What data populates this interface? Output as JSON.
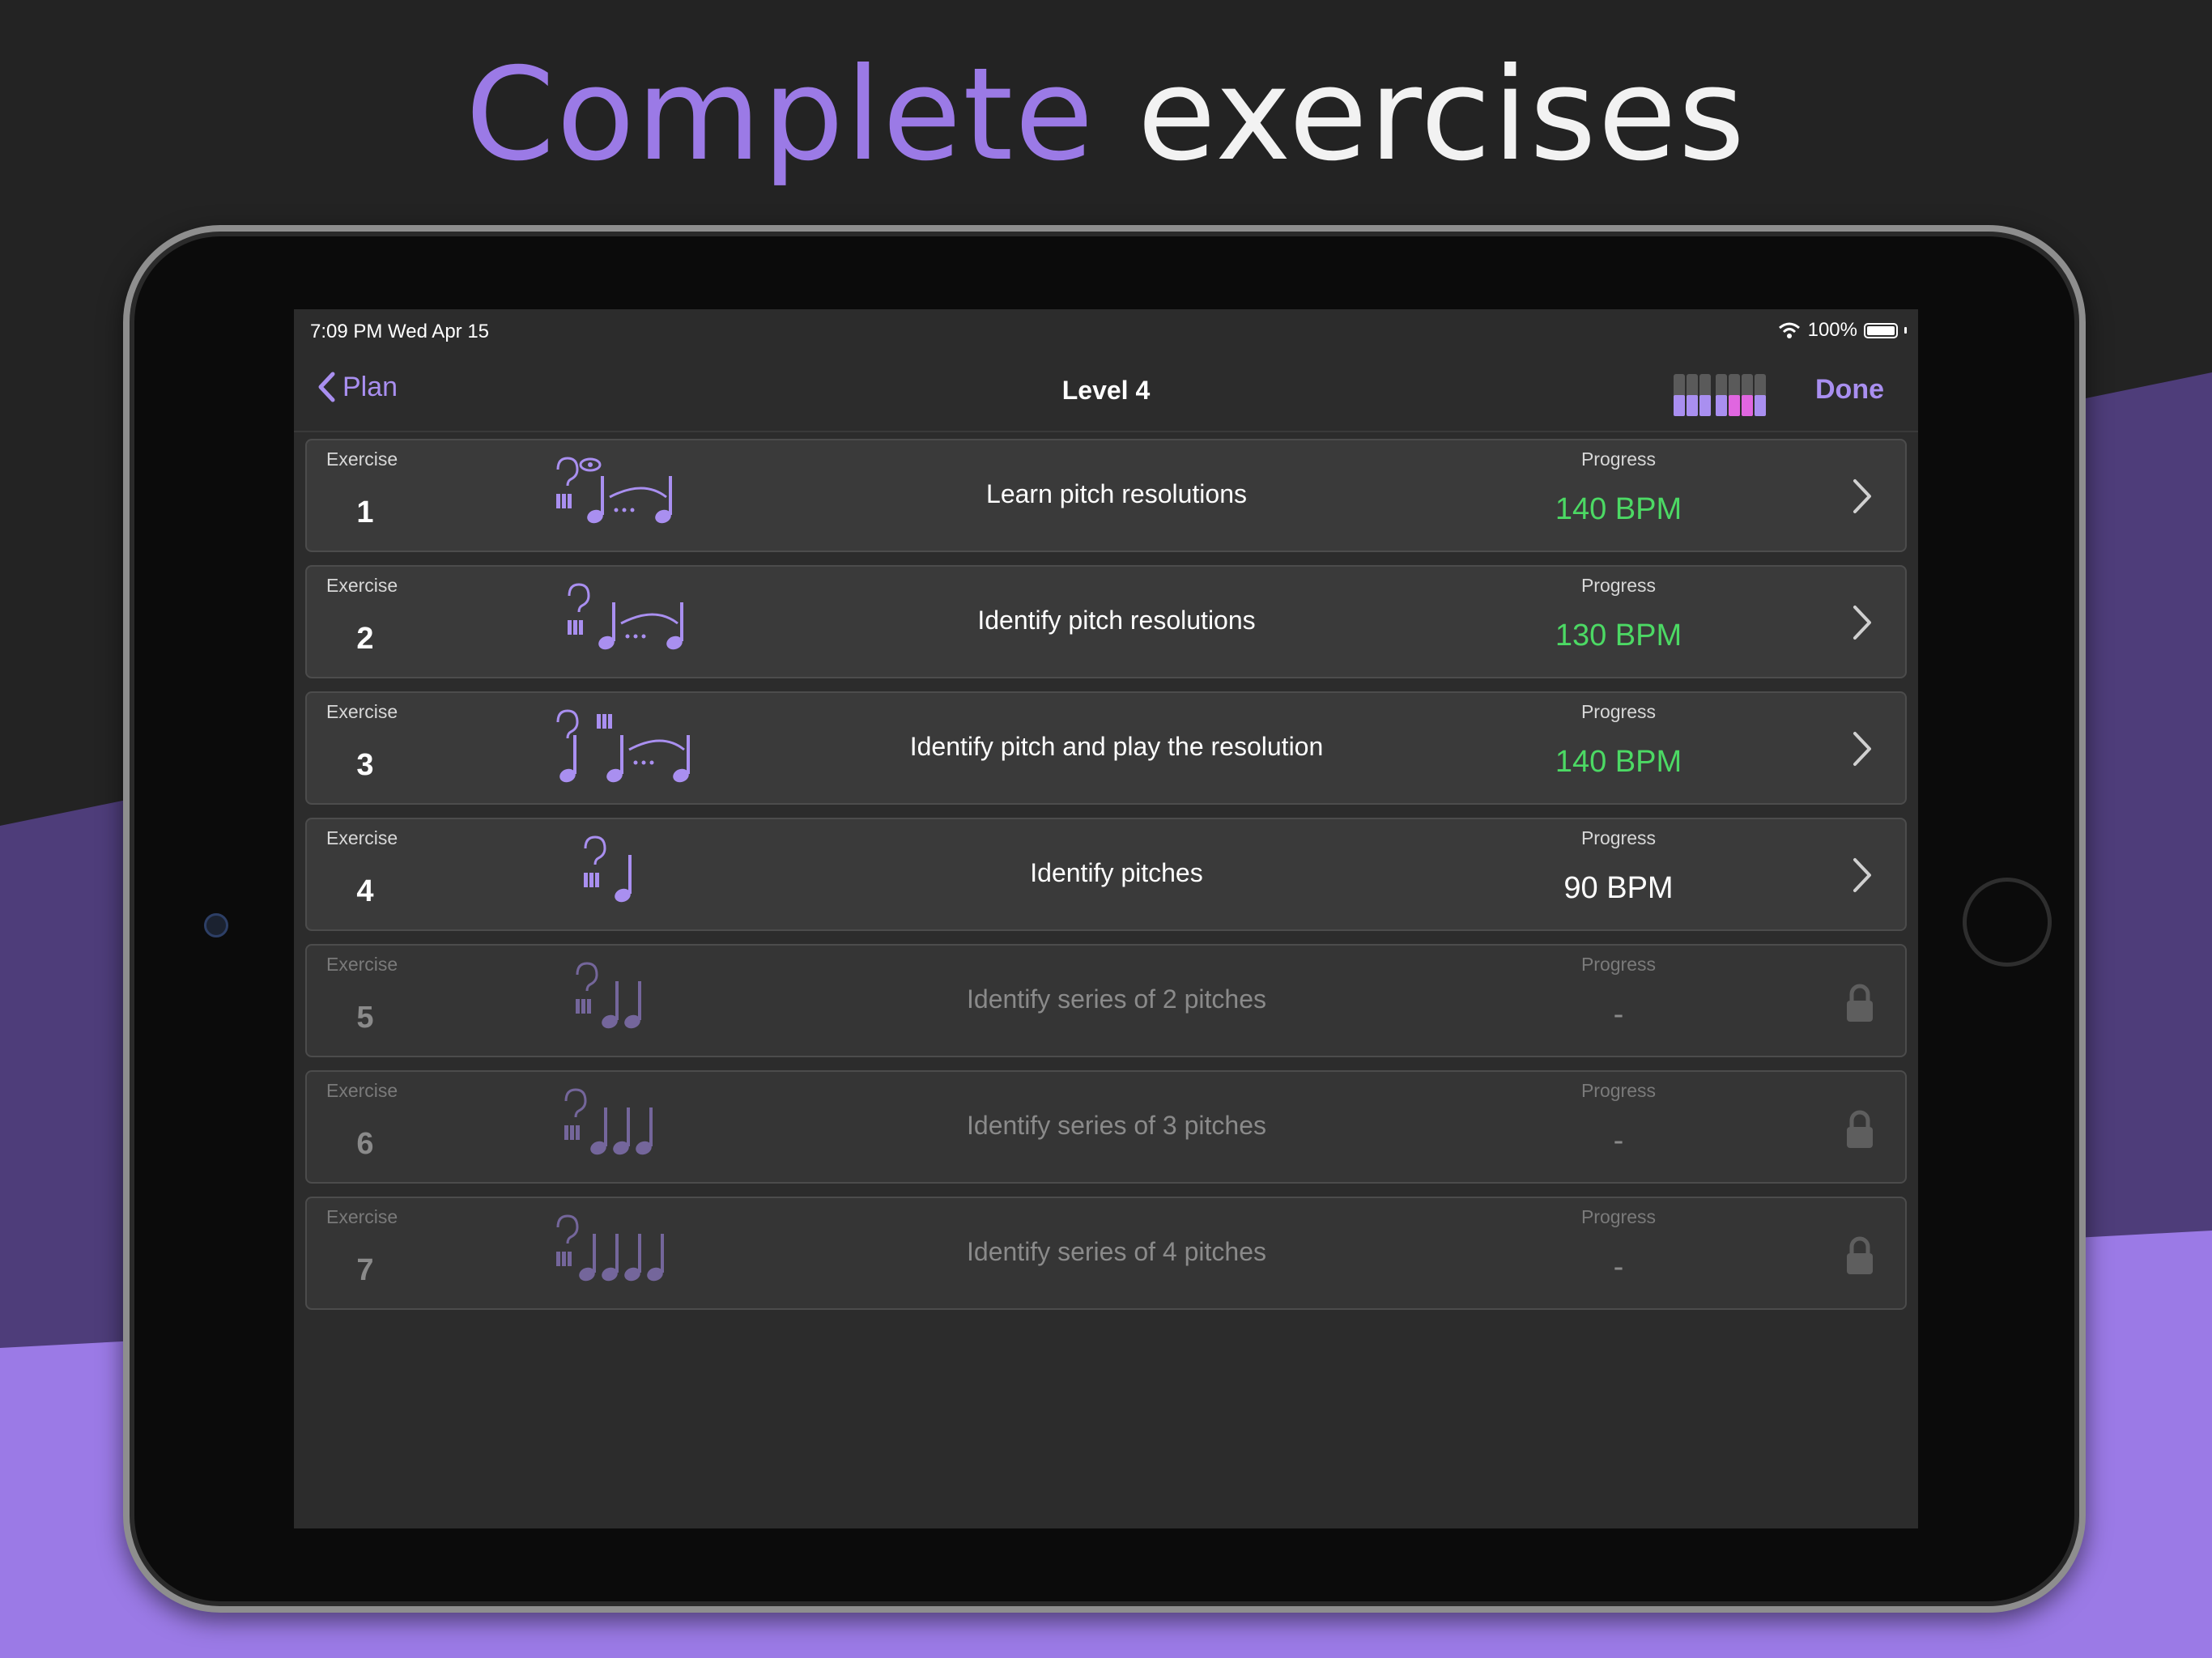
{
  "headline": {
    "accent": "Complete",
    "rest": "exercises"
  },
  "colors": {
    "accent": "#a98ff0",
    "green": "#4cd964",
    "purple_band": "#9b7ae6",
    "dark_band": "#4e3d7a"
  },
  "status": {
    "time": "7:09 PM   Wed Apr 15",
    "battery": "100%"
  },
  "nav": {
    "back": "Plan",
    "title": "Level 4",
    "done": "Done"
  },
  "labels": {
    "exercise": "Exercise",
    "progress": "Progress"
  },
  "exercises": [
    {
      "num": "1",
      "title": "Learn pitch resolutions",
      "progress": "140 BPM",
      "locked": false,
      "progress_color": "#4cd964",
      "icon": "eye-ear-piano-resolution"
    },
    {
      "num": "2",
      "title": "Identify pitch resolutions",
      "progress": "130 BPM",
      "locked": false,
      "progress_color": "#4cd964",
      "icon": "ear-piano-resolution"
    },
    {
      "num": "3",
      "title": "Identify pitch and play the resolution",
      "progress": "140 BPM",
      "locked": false,
      "progress_color": "#4cd964",
      "icon": "ear-note-piano-resolution"
    },
    {
      "num": "4",
      "title": "Identify pitches",
      "progress": "90 BPM",
      "locked": false,
      "progress_color": "#ffffff",
      "icon": "ear-piano-1-note"
    },
    {
      "num": "5",
      "title": "Identify series of 2 pitches",
      "progress": "-",
      "locked": true,
      "progress_color": "#8a8a8a",
      "icon": "ear-piano-2-notes"
    },
    {
      "num": "6",
      "title": "Identify series of 3 pitches",
      "progress": "-",
      "locked": true,
      "progress_color": "#8a8a8a",
      "icon": "ear-piano-3-notes"
    },
    {
      "num": "7",
      "title": "Identify series of 4 pitches",
      "progress": "-",
      "locked": true,
      "progress_color": "#8a8a8a",
      "icon": "ear-piano-4-notes"
    }
  ]
}
